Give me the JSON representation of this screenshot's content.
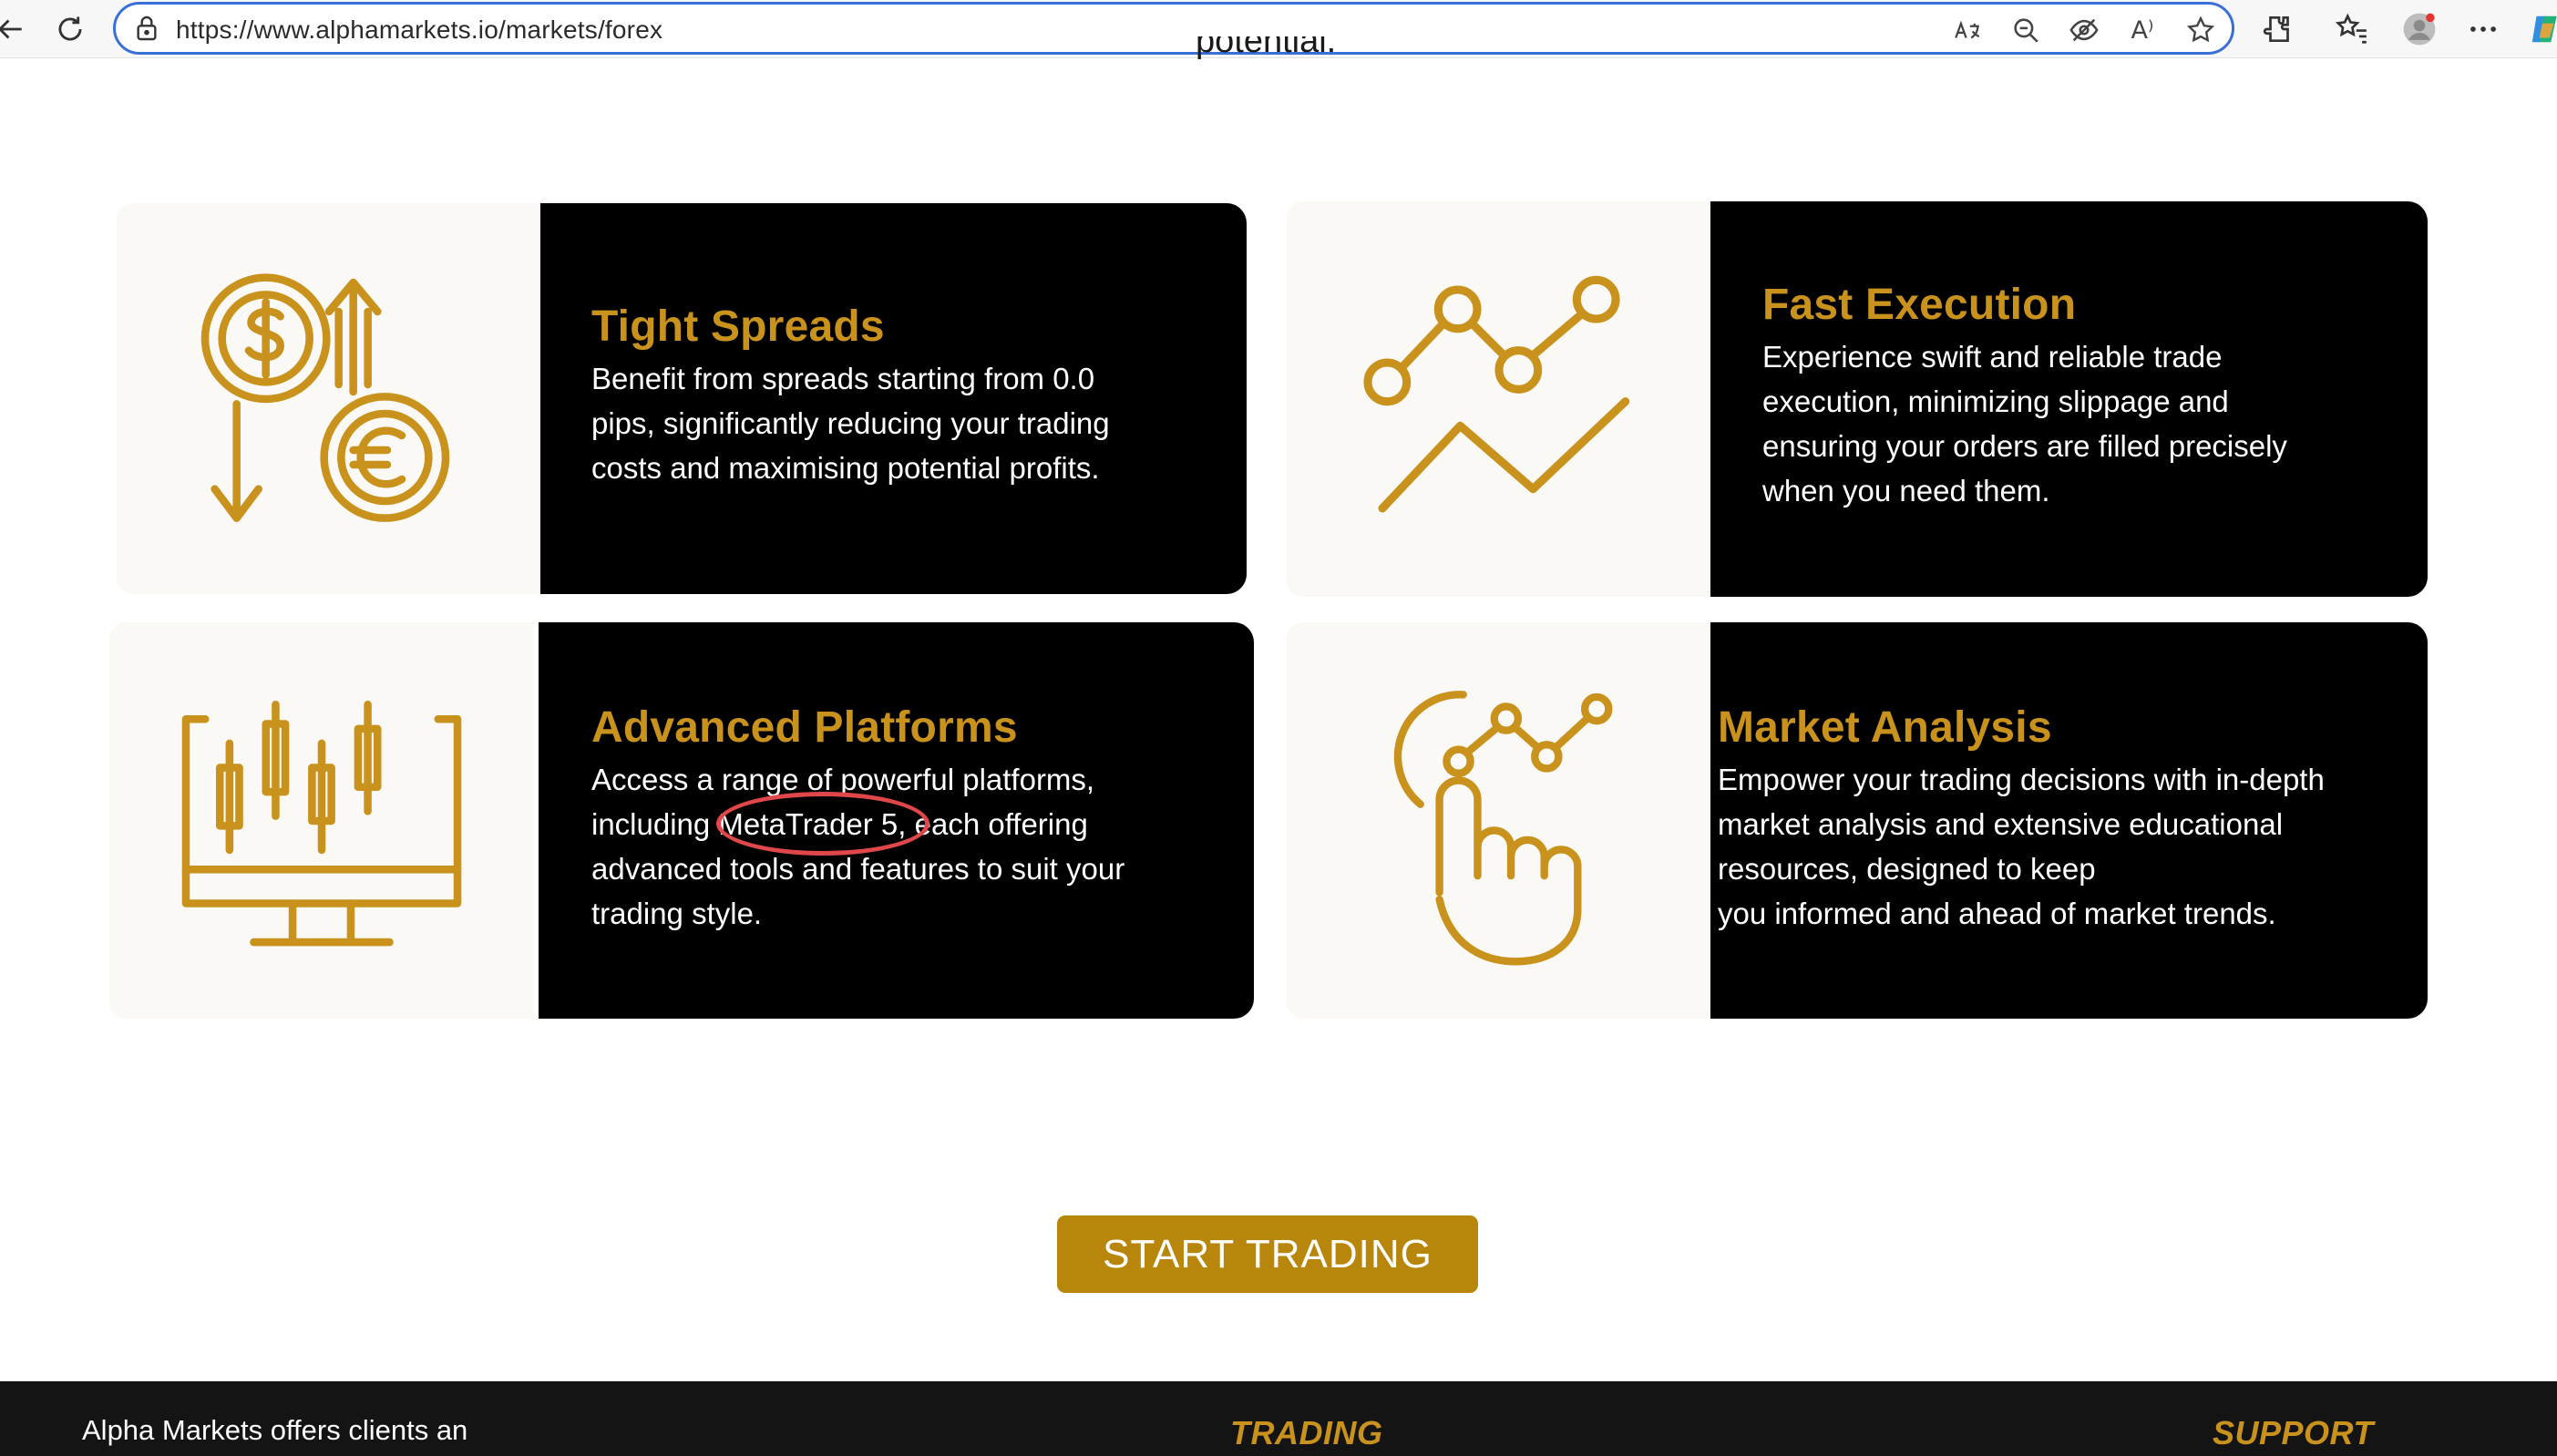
{
  "browser": {
    "url": "https://www.alphamarkets.io/markets/forex",
    "read_aloud_glyph": "A⁾"
  },
  "page": {
    "intro_fragment": "potential."
  },
  "features": [
    {
      "title": "Tight Spreads",
      "text": "Benefit from spreads starting from 0.0\npips, significantly reducing your trading\ncosts and maximising potential profits.",
      "icon": "currency-exchange-icon"
    },
    {
      "title": "Fast Execution",
      "text": "Experience swift and reliable trade\nexecution, minimizing slippage and\nensuring your orders are filled precisely\nwhen you need them.",
      "icon": "trend-line-icon"
    },
    {
      "title": "Advanced Platforms",
      "text": "Access a range of powerful platforms,\nincluding MetaTrader 5, each offering\nadvanced tools and features to suit your\ntrading style.",
      "icon": "candlestick-monitor-icon"
    },
    {
      "title": "Market Analysis",
      "text": "Empower your trading decisions with in-depth\nmarket analysis and extensive educational\nresources, designed to keep\nyou informed and ahead of market trends.",
      "icon": "touch-chart-icon"
    }
  ],
  "cta": {
    "label": "START TRADING"
  },
  "footer": {
    "about_text": "Alpha Markets offers clients an",
    "trading_heading": "TRADING",
    "support_heading": "SUPPORT"
  },
  "colors": {
    "gold": "#c8921d",
    "cta_gold": "#b8860b",
    "panel_black": "#000000",
    "annotation_red": "#e0474a"
  }
}
